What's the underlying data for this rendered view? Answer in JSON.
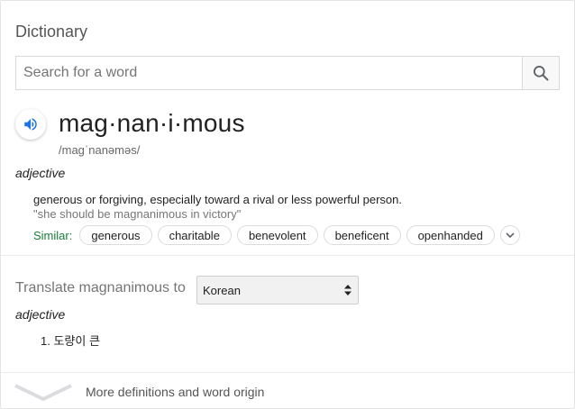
{
  "header": {
    "title": "Dictionary"
  },
  "search": {
    "placeholder": "Search for a word",
    "icon": "search-icon"
  },
  "entry": {
    "word": "mag·nan·i·mous",
    "phonetic": "/maɡˈnanəməs/",
    "part_of_speech": "adjective",
    "definition": "generous or forgiving, especially toward a rival or less powerful person.",
    "example": "\"she should be magnanimous in victory\"",
    "similar_label": "Similar:",
    "similar": [
      "generous",
      "charitable",
      "benevolent",
      "beneficent",
      "openhanded"
    ]
  },
  "translate": {
    "label": "Translate magnanimous to",
    "language": "Korean",
    "part_of_speech": "adjective",
    "items": [
      "1. 도량이 큰"
    ]
  },
  "footer": {
    "more_label": "More definitions and word origin"
  },
  "colors": {
    "accent": "#1a73e8",
    "similar_green": "#188038"
  }
}
